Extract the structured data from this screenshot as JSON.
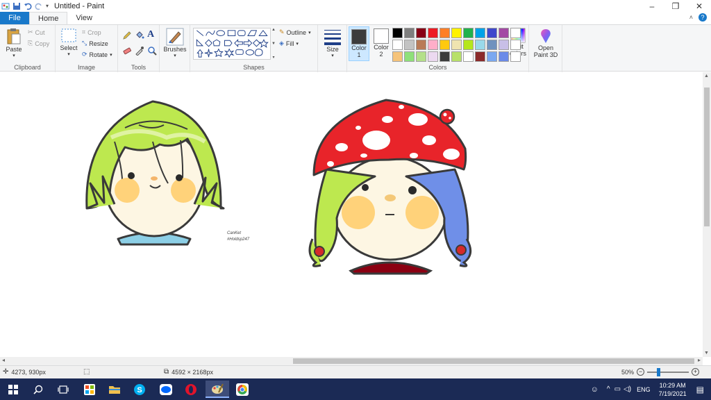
{
  "window": {
    "title": "Untitled - Paint",
    "minimize": "–",
    "restore": "❐",
    "close": "✕"
  },
  "tabs": [
    {
      "label": "File"
    },
    {
      "label": "Home"
    },
    {
      "label": "View"
    }
  ],
  "ribbon": {
    "clipboard": {
      "label": "Clipboard",
      "paste": "Paste",
      "cut": "Cut",
      "copy": "Copy"
    },
    "image": {
      "label": "Image",
      "select": "Select",
      "crop": "Crop",
      "resize": "Resize",
      "rotate": "Rotate"
    },
    "tools": {
      "label": "Tools"
    },
    "brushes": {
      "label": "Brushes"
    },
    "shapes": {
      "label": "Shapes",
      "outline": "Outline",
      "fill": "Fill"
    },
    "size": {
      "label": "Size"
    },
    "colors": {
      "label": "Colors",
      "color1": "Color",
      "color1_num": "1",
      "color2": "Color",
      "color2_num": "2",
      "edit_colors_1": "Edit",
      "edit_colors_2": "colors",
      "color1_value": "#3c3c3c",
      "color2_value": "#ffffff",
      "palette": [
        "#000000",
        "#7f7f7f",
        "#880015",
        "#ed1c24",
        "#ff7f27",
        "#fff200",
        "#22b14c",
        "#00a2e8",
        "#3f48cc",
        "#a349a4",
        "#ffffff",
        "#ffffff",
        "#c3c3c3",
        "#b97a57",
        "#ffaec9",
        "#ffc90e",
        "#efe4b0",
        "#b5e61d",
        "#99d9ea",
        "#7092be",
        "#c8bfe7",
        "#ffffff",
        "#f5c37a",
        "#8fe07a",
        "#b4e08a",
        "#ecd9f0",
        "#3c3c3c",
        "#b8e06a",
        "#ffffff",
        "#8b2a2a",
        "#7aa8f0",
        "#6b8be8",
        "#ffffff"
      ]
    },
    "paint3d": {
      "line1": "Open",
      "line2": "Paint 3D"
    }
  },
  "canvas": {
    "signature_line1": "CanKet",
    "signature_line2": "#Holdsp247"
  },
  "status": {
    "cursor_pos": "4273, 930px",
    "image_size": "4592 × 2168px",
    "zoom": "50%"
  },
  "taskbar": {
    "lang": "ENG",
    "time": "10:29 AM",
    "date": "7/19/2021"
  }
}
